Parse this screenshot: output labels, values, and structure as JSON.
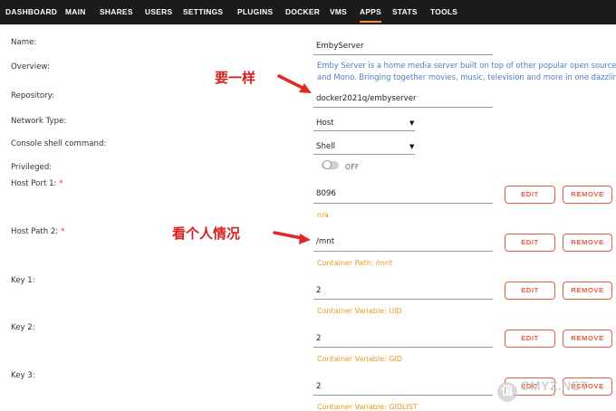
{
  "nav": {
    "items": [
      "DASHBOARD",
      "MAIN",
      "SHARES",
      "USERS",
      "SETTINGS",
      "PLUGINS",
      "DOCKER",
      "VMS",
      "APPS",
      "STATS",
      "TOOLS"
    ],
    "active": "APPS",
    "accent": "#ff8c2f"
  },
  "form": {
    "name_label": "Name:",
    "name_value": "EmbyServer",
    "overview_label": "Overview:",
    "overview_line1": "Emby Server is a home media server built on top of other popular open source technol",
    "overview_line2": "and Mono. Bringing together movies, music, television and more in one dazzling interfac",
    "repository_label": "Repository:",
    "repository_value": "docker2021q/embyserver",
    "network_label": "Network Type:",
    "network_value": "Host",
    "console_label": "Console shell command:",
    "console_value": "Shell",
    "privileged_label": "Privileged:",
    "privileged_state": "OFF",
    "host_port_label": "Host Port 1:",
    "host_port_value": "8096",
    "host_port_sub": "n/a",
    "host_path_label": "Host Path 2:",
    "host_path_value": "/mnt",
    "host_path_sub": "Container Path: /mnt",
    "key1_label": "Key 1:",
    "key1_value": "2",
    "key1_sub": "Container Variable: UID",
    "key2_label": "Key 2:",
    "key2_value": "2",
    "key2_sub": "Container Variable: GID",
    "key3_label": "Key 3:",
    "key3_value": "2",
    "key3_sub": "Container Variable: GIDLIST",
    "required_mark": "*"
  },
  "buttons": {
    "edit": "EDIT",
    "remove": "REMOVE",
    "color": "#e35e43"
  },
  "annotations": {
    "same": "要一样",
    "depends": "看个人情况",
    "color": "#d62020"
  },
  "watermark": {
    "text": "SMYZ.NET",
    "icon_glyph": "值"
  }
}
